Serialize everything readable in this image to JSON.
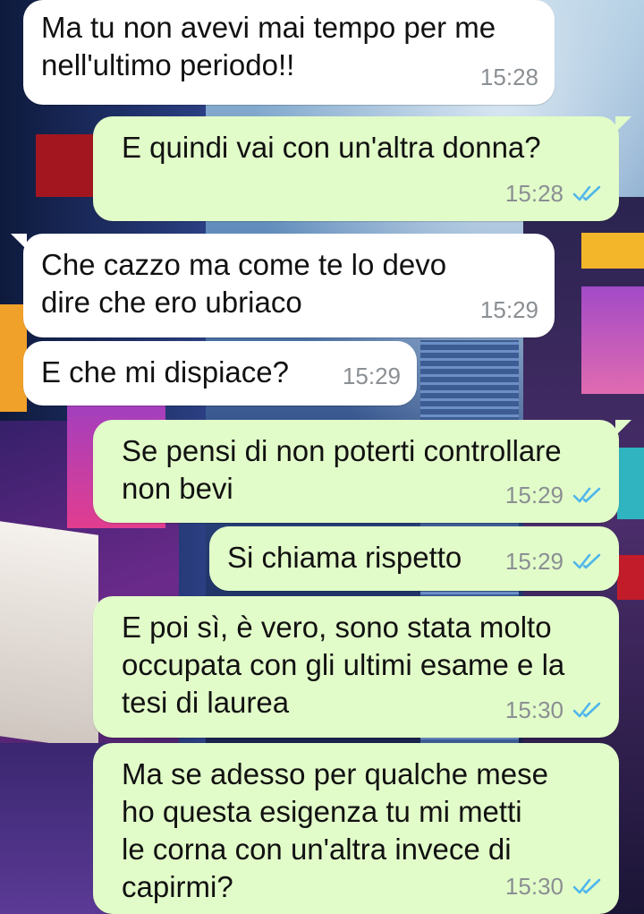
{
  "colors": {
    "incoming_bubble": "#ffffff",
    "outgoing_bubble": "#e2fcc9",
    "timestamp": "#8a8f93",
    "read_ticks": "#4fb6ec"
  },
  "icons": {
    "read_receipt": "double-check-icon"
  },
  "messages": [
    {
      "direction": "in",
      "text": "Ma tu non avevi mai tempo per me\nnell'ultimo periodo!!",
      "time": "15:28"
    },
    {
      "direction": "out",
      "text": "E quindi vai con un'altra donna?",
      "time": "15:28",
      "read": true
    },
    {
      "direction": "in",
      "text": "Che cazzo ma come te lo devo\ndire che ero ubriaco",
      "time": "15:29"
    },
    {
      "direction": "in",
      "text": "E che mi dispiace?",
      "time": "15:29"
    },
    {
      "direction": "out",
      "text": "Se pensi di non poterti controllare\nnon bevi",
      "time": "15:29",
      "read": true
    },
    {
      "direction": "out",
      "text": "Si chiama rispetto",
      "time": "15:29",
      "read": true
    },
    {
      "direction": "out",
      "text": "E poi sì, è vero, sono stata molto\noccupata con gli ultimi esame e la\ntesi di laurea",
      "time": "15:30",
      "read": true
    },
    {
      "direction": "out",
      "text": "Ma se adesso per qualche mese\nho questa esigenza tu mi metti\nle corna con un'altra invece di\ncapirmi?",
      "time": "15:30",
      "read": true
    }
  ]
}
